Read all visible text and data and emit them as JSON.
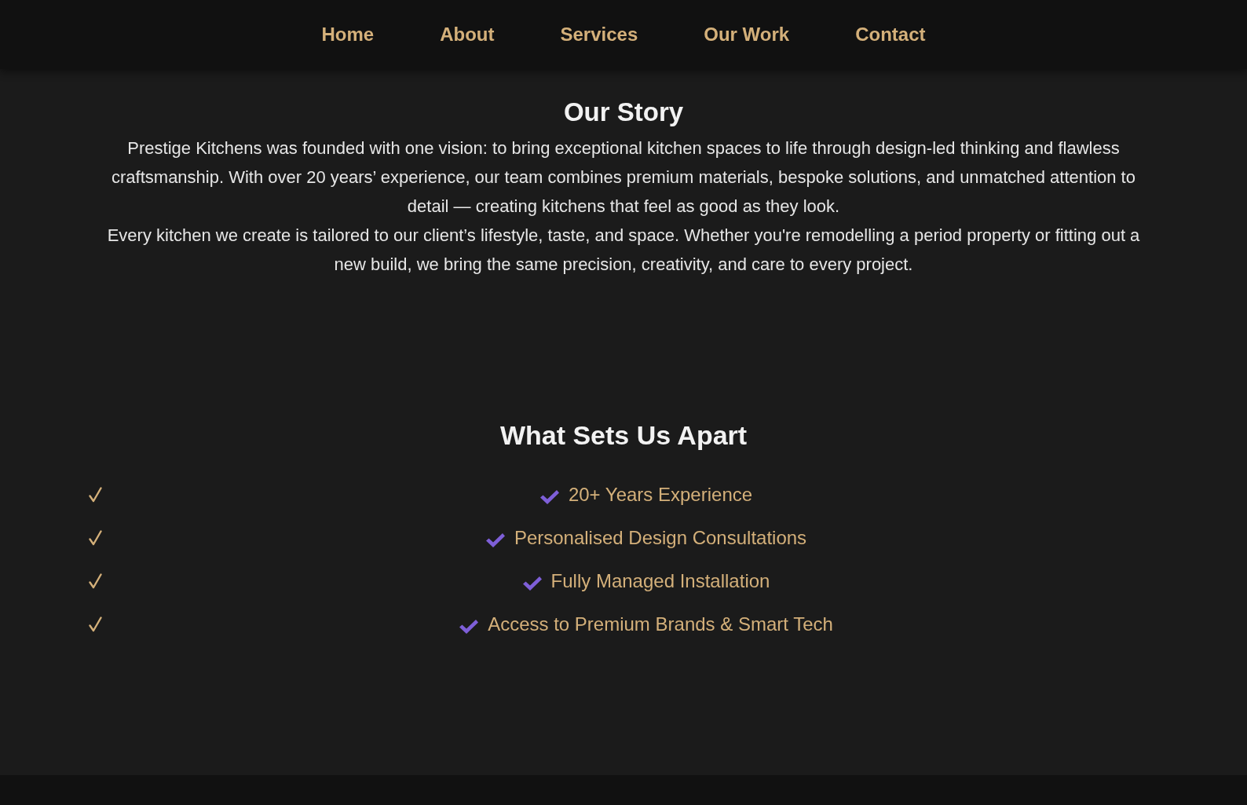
{
  "nav": {
    "items": [
      "Home",
      "About",
      "Services",
      "Our Work",
      "Contact"
    ]
  },
  "story": {
    "title": "Our Story",
    "paragraphs": [
      "Prestige Kitchens was founded with one vision: to bring exceptional kitchen spaces to life through design-led thinking and flawless craftsmanship. With over 20 years’ experience, our team combines premium materials, bespoke solutions, and unmatched attention to detail — creating kitchens that feel as good as they look.",
      "Every kitchen we create is tailored to our client’s lifestyle, taste, and space. Whether you're remodelling a period property or fitting out a new build, we bring the same precision, creativity, and care to every project."
    ]
  },
  "features": {
    "title": "What Sets Us Apart",
    "items": [
      "20+ Years Experience",
      "Personalised Design Consultations",
      "Fully Managed Installation",
      "Access to Premium Brands & Smart Tech"
    ]
  }
}
